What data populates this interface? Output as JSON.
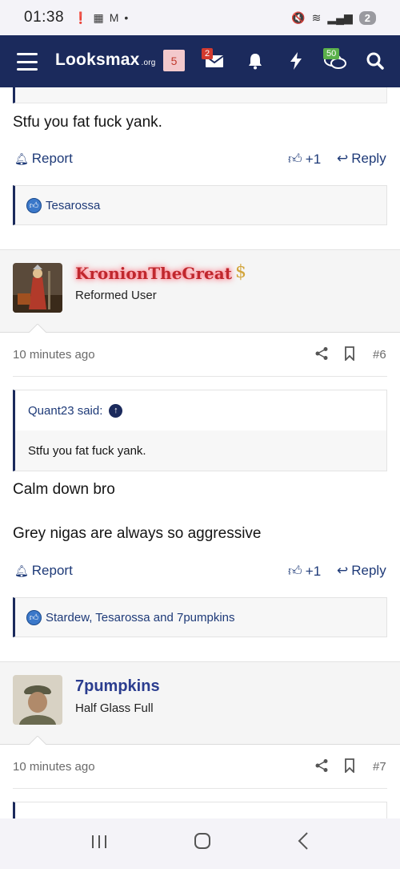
{
  "status_bar": {
    "time": "01:38",
    "battery": "2"
  },
  "navbar": {
    "logo_main": "Looksmax",
    "logo_suffix": ".org",
    "unread_badge": "5",
    "messages_badge": "2",
    "chat_badge": "50"
  },
  "posts": [
    {
      "text": "Stfu you fat fuck yank.",
      "report_label": "Report",
      "like_count": "+1",
      "reply_label": "Reply",
      "reactions": "Tesarossa"
    },
    {
      "username": "KronionTheGreat",
      "user_title": "Reformed User",
      "time": "10 minutes ago",
      "post_number": "#6",
      "quote_author": "Quant23 said:",
      "quote_text": "Stfu you fat fuck yank.",
      "text_line1": "Calm down bro",
      "text_line2": "Grey nigas are always so aggressive",
      "report_label": "Report",
      "like_count": "+1",
      "reply_label": "Reply",
      "reactions": "Stardew, Tesarossa and 7pumpkins"
    },
    {
      "username": "7pumpkins",
      "user_title": "Half Glass Full",
      "time": "10 minutes ago",
      "post_number": "#7"
    }
  ],
  "icons": {
    "menu": "hamburger-icon",
    "messages": "envelope-icon",
    "alerts": "bell-icon",
    "whats_new": "lightning-icon",
    "chat": "chat-bubbles-icon",
    "search": "search-icon"
  },
  "colors": {
    "navbar_bg": "#1b2a5c",
    "link": "#1e3a78",
    "username_glow": "#c0272d"
  }
}
